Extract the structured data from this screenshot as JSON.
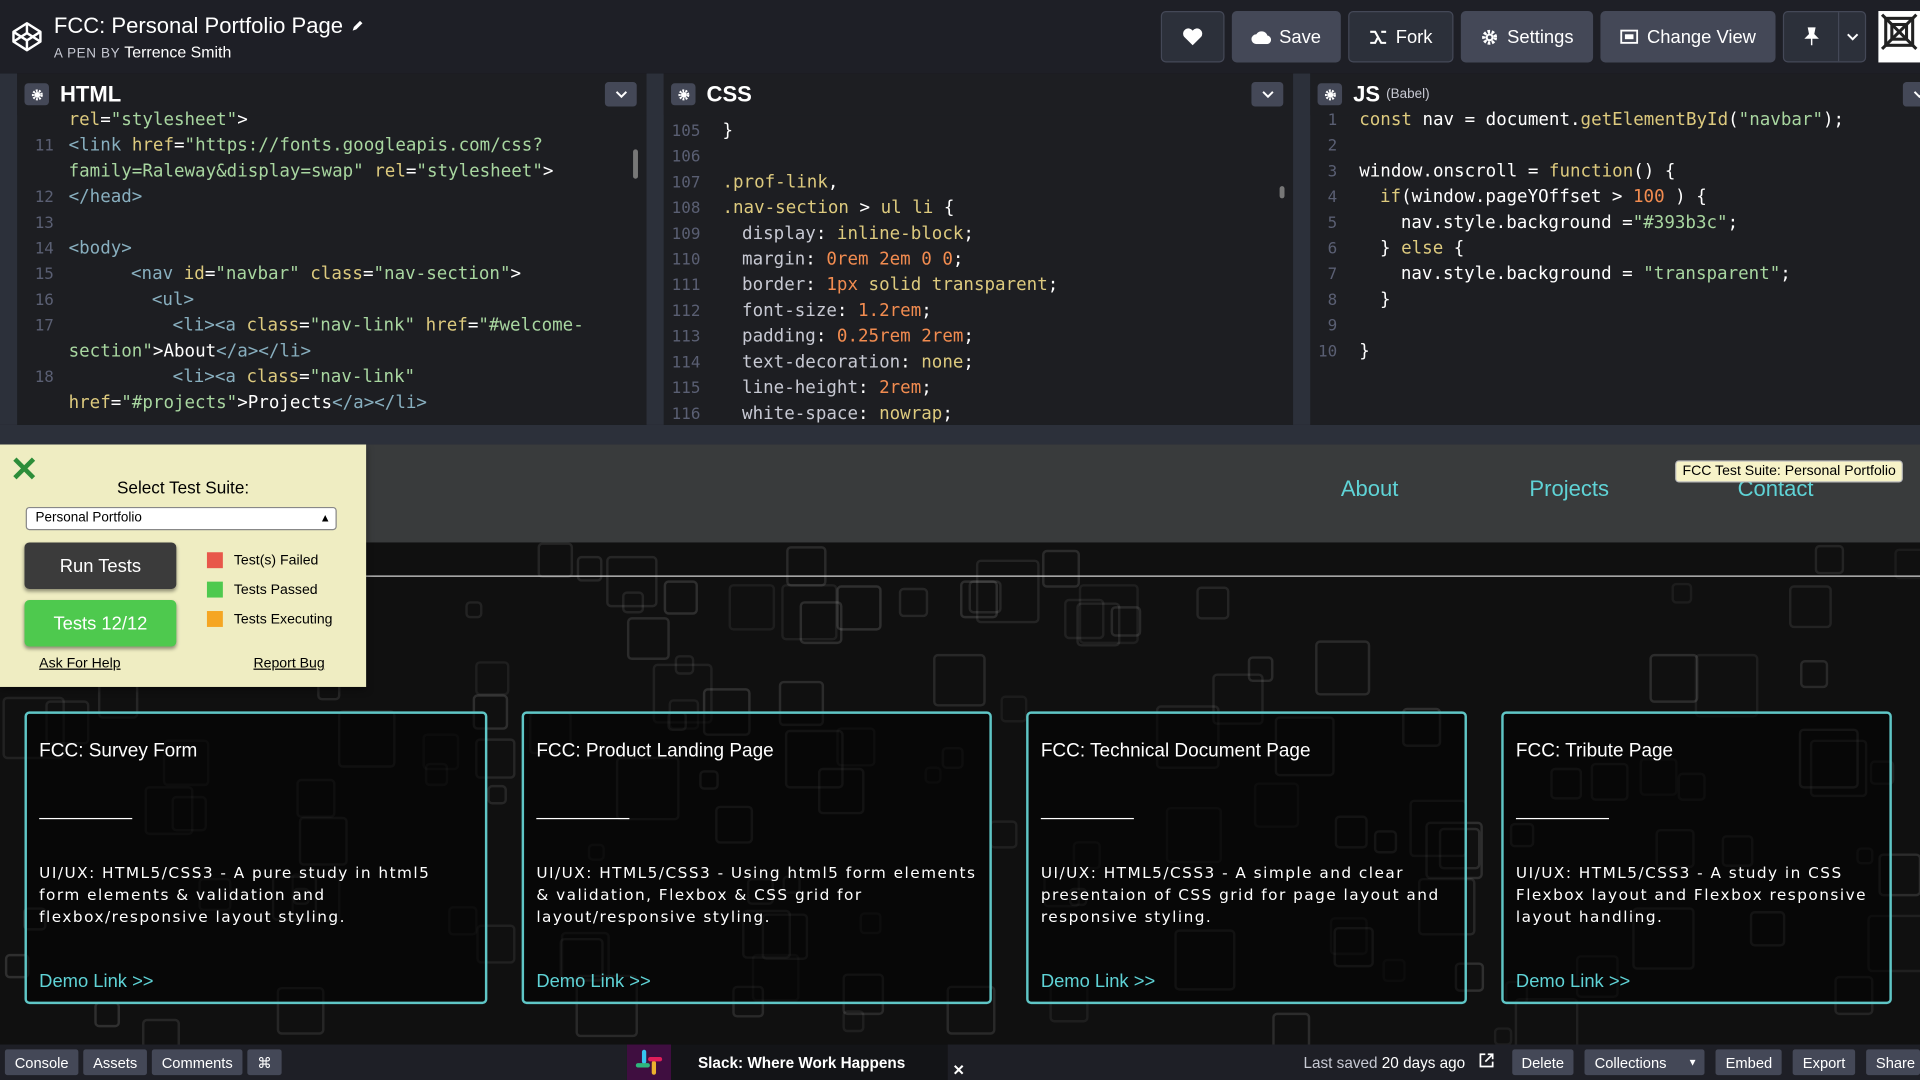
{
  "header": {
    "title": "FCC: Personal Portfolio Page",
    "by_label": "A PEN BY",
    "author": "Terrence Smith",
    "save_label": "Save",
    "fork_label": "Fork",
    "settings_label": "Settings",
    "change_view_label": "Change View"
  },
  "editors": {
    "html": {
      "title": "HTML"
    },
    "css": {
      "title": "CSS"
    },
    "js": {
      "title": "JS",
      "subtitle": "(Babel)"
    }
  },
  "preview": {
    "nav": {
      "about": "About",
      "projects": "Projects",
      "contact": "Contact"
    },
    "suite_badge": "FCC Test Suite: Personal Portfolio",
    "cards": [
      {
        "title": "FCC: Survey Form",
        "desc": "UI/UX: HTML5/CSS3 - A pure study in html5 form elements & validation and flexbox/responsive layout styling.",
        "link": "Demo Link >>"
      },
      {
        "title": "FCC: Product Landing Page",
        "desc": "UI/UX: HTML5/CSS3 - Using html5 form elements & validation, Flexbox & CSS grid for layout/responsive styling.",
        "link": "Demo Link >>"
      },
      {
        "title": "FCC: Technical Document Page",
        "desc": "UI/UX: HTML5/CSS3 - A simple and clear presentaion of CSS grid for page layout and responsive styling.",
        "link": "Demo Link >>"
      },
      {
        "title": "FCC: Tribute Page",
        "desc": "UI/UX: HTML5/CSS3 - A study in CSS Flexbox layout and Flexbox responsive layout handling.",
        "link": "Demo Link >>"
      }
    ]
  },
  "test_panel": {
    "title": "Select Test Suite:",
    "selected_suite": "Personal Portfolio",
    "run_label": "Run Tests",
    "result_label": "Tests 12/12",
    "legend_failed": "Test(s) Failed",
    "legend_passed": "Tests Passed",
    "legend_executing": "Tests Executing",
    "help_link": "Ask For Help",
    "bug_link": "Report Bug",
    "colors": {
      "failed": "#e8574a",
      "passed": "#4ec94e",
      "executing": "#f5a623"
    }
  },
  "footer": {
    "console": "Console",
    "assets": "Assets",
    "comments": "Comments",
    "cmd": "⌘",
    "slack_text": "Slack: Where Work Happens",
    "saved_prefix": "Last saved",
    "saved_time": "20 days ago",
    "delete": "Delete",
    "collections": "Collections",
    "embed": "Embed",
    "export": "Export",
    "share": "Share"
  },
  "colors": {
    "accent": "#5fd3d6",
    "topbar": "#1e1f26",
    "button": "#444857"
  }
}
